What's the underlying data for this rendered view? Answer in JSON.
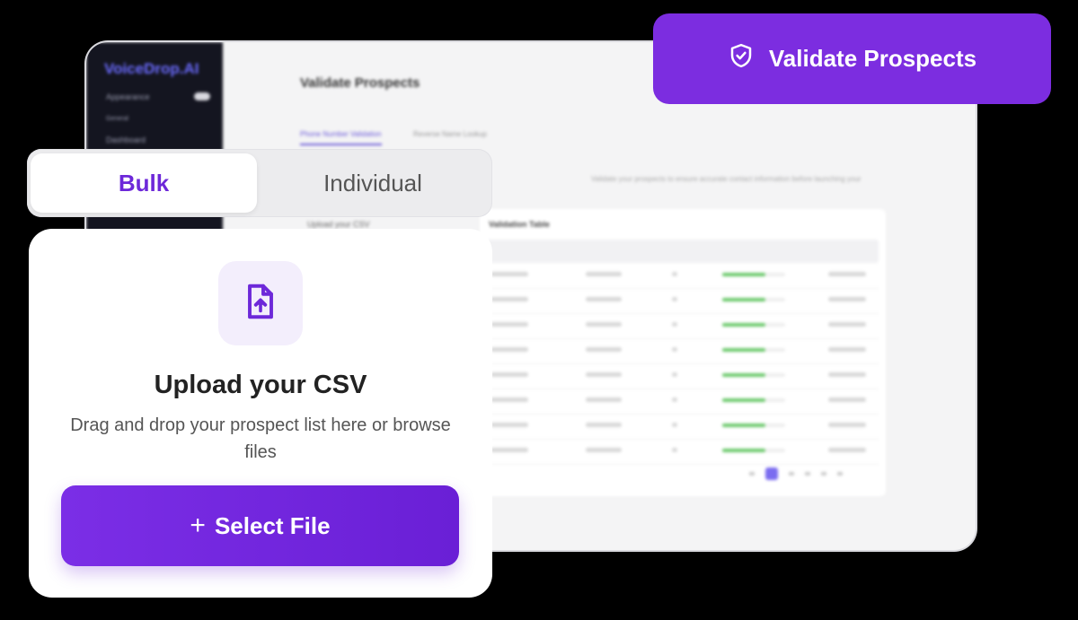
{
  "background_app": {
    "brand": "VoiceDrop",
    "brand_suffix": ".AI",
    "sidebar": {
      "appearance_label": "Appearance",
      "section_label": "General",
      "item_dashboard": "Dashboard"
    },
    "page_title": "Validate Prospects",
    "tabs": [
      "Phone Number Validation",
      "Reverse Name Lookup"
    ],
    "description": "Validate your prospects to ensure accurate contact information before launching your",
    "upload_label": "Upload your CSV",
    "table_title": "Validation Table"
  },
  "validate_button": {
    "label": "Validate Prospects",
    "icon": "shield-check-icon"
  },
  "segmented": {
    "bulk": "Bulk",
    "individual": "Individual"
  },
  "upload": {
    "icon": "file-upload-icon",
    "title": "Upload your CSV",
    "subtitle": "Drag and drop your prospect list here or browse files",
    "button_label": "Select File",
    "button_icon": "plus-icon"
  },
  "colors": {
    "accent": "#7c2de0",
    "accent_text": "#6d28d9",
    "icon_bg": "#f3eefc"
  }
}
